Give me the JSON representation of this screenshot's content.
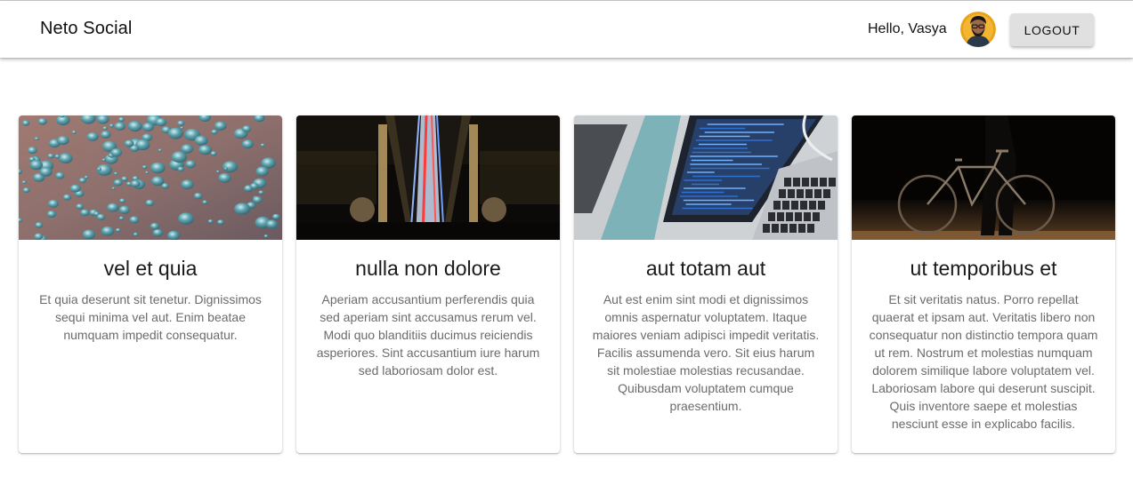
{
  "header": {
    "brand": "Neto Social",
    "greeting": "Hello, Vasya",
    "avatar_icon": "user-avatar-icon",
    "logout_label": "LOGOUT"
  },
  "cards": [
    {
      "title": "vel et quia",
      "text": "Et quia deserunt sit tenetur. Dignissimos sequi minima vel aut. Enim beatae numquam impedit consequatur.",
      "image": "water-droplets-image"
    },
    {
      "title": "nulla non dolore",
      "text": "Aperiam accusantium perferendis quia sed aperiam sint accusamus rerum vel. Modi quo blanditiis ducimus reiciendis asperiores. Sint accusantium iure harum sed laboriosam dolor est.",
      "image": "night-bridge-image"
    },
    {
      "title": "aut totam aut",
      "text": "Aut est enim sint modi et dignissimos omnis aspernatur voluptatem. Itaque maiores veniam adipisci impedit veritatis. Facilis assumenda vero. Sit eius harum sit molestiae molestias recusandae. Quibusdam voluptatem cumque praesentium.",
      "image": "laptop-image"
    },
    {
      "title": "ut temporibus et",
      "text": "Et sit veritatis natus. Porro repellat quaerat et ipsam aut. Veritatis libero non consequatur non distinctio tempora quam ut rem. Nostrum et molestias numquam dolorem similique labore voluptatem vel. Laboriosam labore qui deserunt suscipit. Quis inventore saepe et molestias nesciunt esse in explicabo facilis.",
      "image": "bicycle-image"
    }
  ]
}
